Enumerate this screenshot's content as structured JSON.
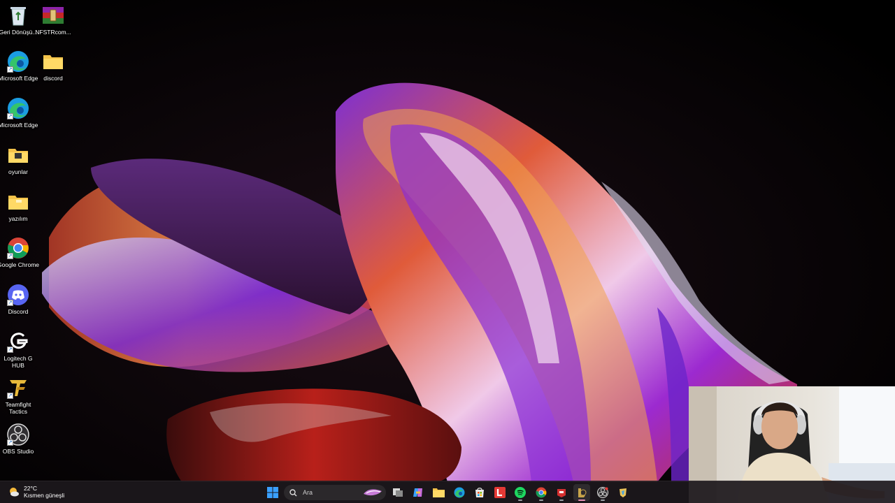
{
  "desktop": {
    "icons": [
      {
        "label": "Geri Dönüşü...",
        "icon": "recycle-bin-icon"
      },
      {
        "label": "NFSTRcom...",
        "icon": "winrar-archive-icon"
      },
      {
        "label": "Microsoft Edge",
        "icon": "edge-icon"
      },
      {
        "label": "discord",
        "icon": "folder-icon"
      },
      {
        "label": "Microsoft Edge",
        "icon": "edge-icon"
      },
      {
        "label": "oyunlar",
        "icon": "folder-icon"
      },
      {
        "label": "yazılım",
        "icon": "folder-icon"
      },
      {
        "label": "Google Chrome",
        "icon": "chrome-icon"
      },
      {
        "label": "Discord",
        "icon": "discord-icon"
      },
      {
        "label": "Logitech G HUB",
        "icon": "logitech-g-icon"
      },
      {
        "label": "Teamfight Tactics",
        "icon": "tft-icon"
      },
      {
        "label": "OBS Studio",
        "icon": "obs-icon"
      }
    ]
  },
  "taskbar": {
    "weather": {
      "temperature": "22°C",
      "condition": "Kısmen güneşli",
      "icon": "partly-sunny-icon"
    },
    "search": {
      "placeholder": "Ara",
      "icon": "search-icon"
    },
    "apps": [
      {
        "name": "start",
        "icon": "windows-logo-icon"
      },
      {
        "name": "task-view",
        "icon": "task-view-icon"
      },
      {
        "name": "copilot",
        "icon": "copilot-icon"
      },
      {
        "name": "file-explorer",
        "icon": "folder-icon"
      },
      {
        "name": "edge",
        "icon": "edge-icon"
      },
      {
        "name": "store",
        "icon": "store-icon"
      },
      {
        "name": "lightshot",
        "icon": "l-app-icon"
      },
      {
        "name": "spotify",
        "icon": "spotify-icon"
      },
      {
        "name": "chrome",
        "icon": "chrome-icon"
      },
      {
        "name": "red-app",
        "icon": "red-app-icon"
      },
      {
        "name": "league-client",
        "icon": "league-icon"
      },
      {
        "name": "obs",
        "icon": "obs-icon"
      },
      {
        "name": "riot-app",
        "icon": "riot-client-icon"
      }
    ]
  },
  "colors": {
    "accent": "#e891b7",
    "taskbar": "#1c181c",
    "windows_blue": "#3aa0ff"
  }
}
